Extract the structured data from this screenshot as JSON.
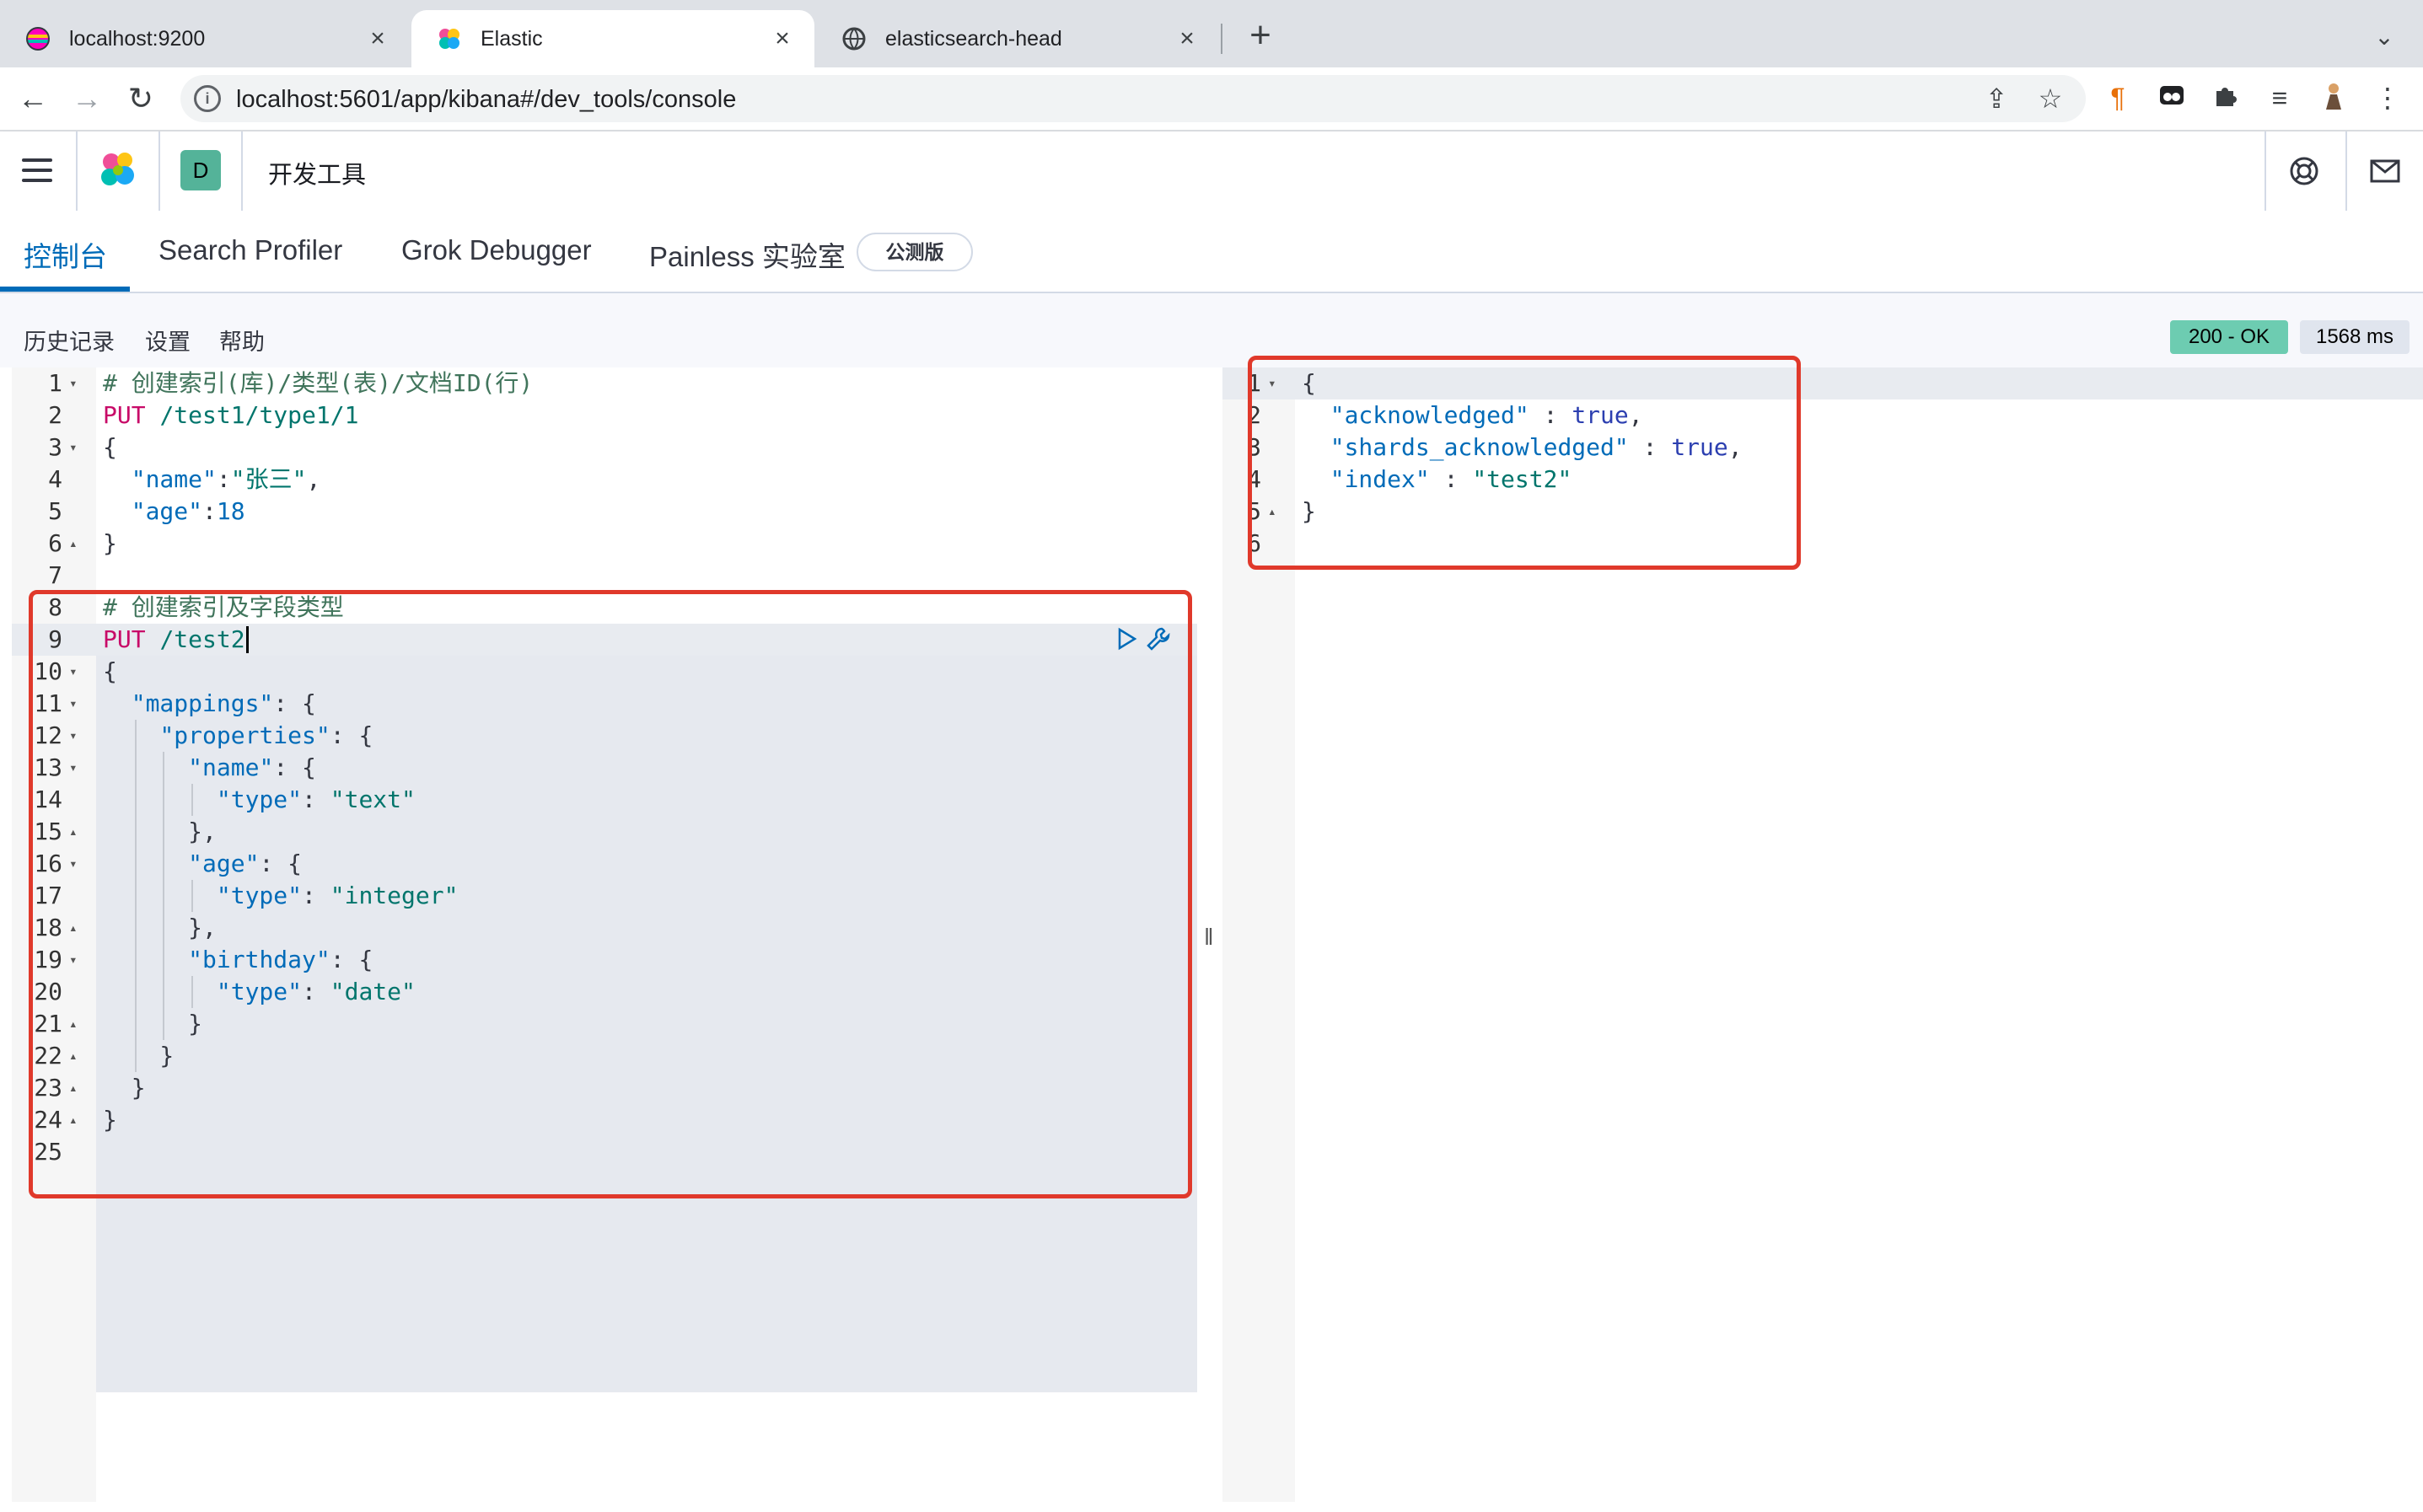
{
  "browser": {
    "tabs": [
      {
        "title": "localhost:9200",
        "active": false
      },
      {
        "title": "Elastic",
        "active": true
      },
      {
        "title": "elasticsearch-head",
        "active": false
      }
    ],
    "url": "localhost:5601/app/kibana#/dev_tools/console"
  },
  "kibana": {
    "space_initial": "D",
    "app_title": "开发工具"
  },
  "devtools_tabs": [
    {
      "label": "控制台",
      "selected": true
    },
    {
      "label": "Search Profiler",
      "selected": false
    },
    {
      "label": "Grok Debugger",
      "selected": false
    },
    {
      "label": "Painless 实验室",
      "selected": false
    }
  ],
  "beta_badge": "公测版",
  "console_menu": {
    "history": "历史记录",
    "settings": "设置",
    "help": "帮助"
  },
  "response_status": {
    "code": "200 - OK",
    "time": "1568 ms"
  },
  "request_lines": [
    {
      "n": "1",
      "fold": "▾",
      "text": "# 创建索引(库)/类型(表)/文档ID(行)"
    },
    {
      "n": "2",
      "fold": "",
      "text": "PUT /test1/type1/1"
    },
    {
      "n": "3",
      "fold": "▾",
      "text": "{"
    },
    {
      "n": "4",
      "fold": "",
      "text": "  \"name\":\"张三\","
    },
    {
      "n": "5",
      "fold": "",
      "text": "  \"age\":18"
    },
    {
      "n": "6",
      "fold": "▴",
      "text": "}"
    },
    {
      "n": "7",
      "fold": "",
      "text": ""
    },
    {
      "n": "8",
      "fold": "",
      "text": "# 创建索引及字段类型"
    },
    {
      "n": "9",
      "fold": "",
      "text": "PUT /test2"
    },
    {
      "n": "10",
      "fold": "▾",
      "text": "{"
    },
    {
      "n": "11",
      "fold": "▾",
      "text": "  \"mappings\": {"
    },
    {
      "n": "12",
      "fold": "▾",
      "text": "    \"properties\": {"
    },
    {
      "n": "13",
      "fold": "▾",
      "text": "      \"name\": {"
    },
    {
      "n": "14",
      "fold": "",
      "text": "        \"type\": \"text\""
    },
    {
      "n": "15",
      "fold": "▴",
      "text": "      },"
    },
    {
      "n": "16",
      "fold": "▾",
      "text": "      \"age\": {"
    },
    {
      "n": "17",
      "fold": "",
      "text": "        \"type\": \"integer\""
    },
    {
      "n": "18",
      "fold": "▴",
      "text": "      },"
    },
    {
      "n": "19",
      "fold": "▾",
      "text": "      \"birthday\": {"
    },
    {
      "n": "20",
      "fold": "",
      "text": "        \"type\": \"date\""
    },
    {
      "n": "21",
      "fold": "▴",
      "text": "      }"
    },
    {
      "n": "22",
      "fold": "▴",
      "text": "    }"
    },
    {
      "n": "23",
      "fold": "▴",
      "text": "  }"
    },
    {
      "n": "24",
      "fold": "▴",
      "text": "}"
    },
    {
      "n": "25",
      "fold": "",
      "text": ""
    }
  ],
  "response_lines": [
    {
      "n": "1",
      "fold": "▾",
      "text": "{"
    },
    {
      "n": "2",
      "fold": "",
      "text": "  \"acknowledged\" : true,"
    },
    {
      "n": "3",
      "fold": "",
      "text": "  \"shards_acknowledged\" : true,"
    },
    {
      "n": "4",
      "fold": "",
      "text": "  \"index\" : \"test2\""
    },
    {
      "n": "5",
      "fold": "▴",
      "text": "}"
    },
    {
      "n": "6",
      "fold": "",
      "text": ""
    }
  ],
  "icons": {
    "run": "play-icon",
    "wrench": "wrench-icon",
    "help": "help-icon",
    "mail": "mail-icon"
  },
  "colors": {
    "accent": "#006bb8",
    "ok_badge": "#6dccb1",
    "annotation": "#e0392b"
  }
}
